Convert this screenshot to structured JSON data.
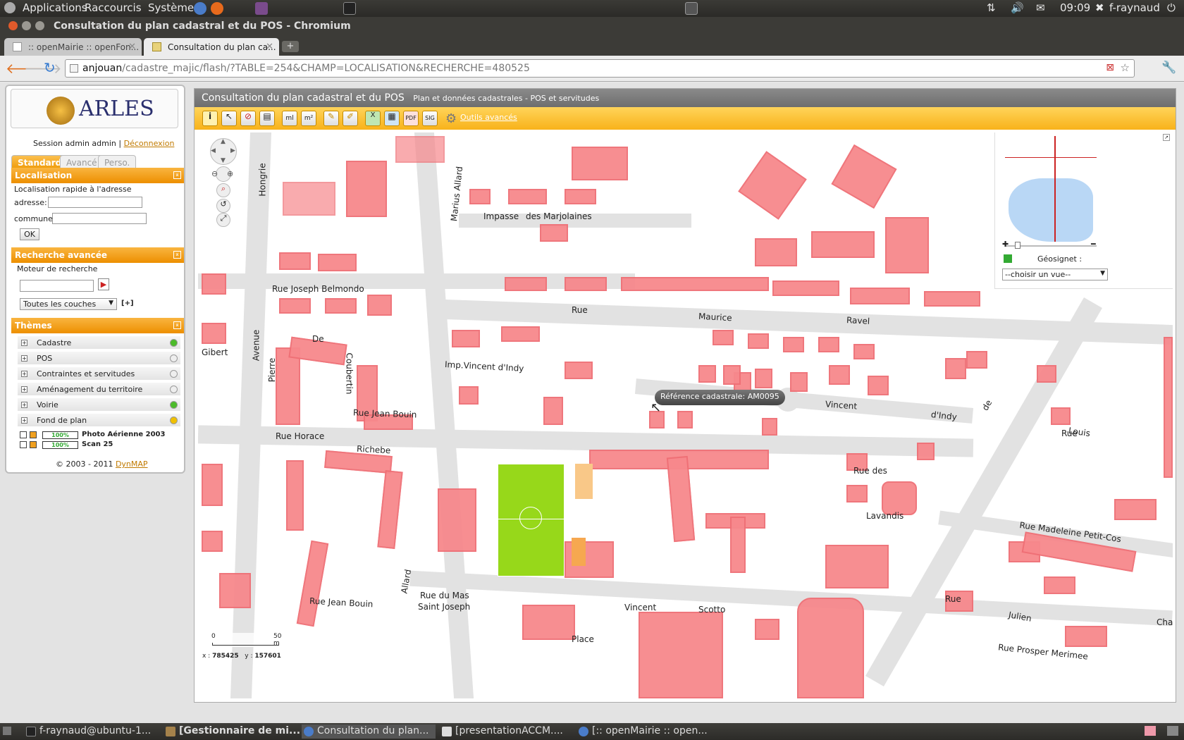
{
  "system_panel": {
    "menus": [
      "Applications",
      "Raccourcis",
      "Système"
    ],
    "clock": "09:09",
    "user": "f-raynaud"
  },
  "window": {
    "title": "Consultation du plan cadastral et du POS - Chromium"
  },
  "tabs": [
    {
      "label": ":: openMairie :: openFon...",
      "active": false
    },
    {
      "label": "Consultation du plan ca...",
      "active": true
    }
  ],
  "url": {
    "host": "anjouan",
    "path": "/cadastre_majic/flash/?TABLE=254&CHAMP=LOCALISATION&RECHERCHE=480525"
  },
  "left_panel": {
    "logo_text": "ARLES",
    "session_text": "Session admin admin |",
    "logout_link": "Déconnexion",
    "tabs": [
      "Standard",
      "Avancé",
      "Perso."
    ],
    "localisation": {
      "header": "Localisation",
      "quick_label": "Localisation rapide à l'adresse",
      "address_label": "adresse:",
      "commune_label": "commune",
      "ok_label": "OK"
    },
    "advanced": {
      "header": "Recherche avancée",
      "engine_label": "Moteur de recherche",
      "layers_select": "Toutes les couches",
      "expand": "[+]"
    },
    "themes": {
      "header": "Thèmes",
      "items": [
        {
          "label": "Cadastre",
          "status_color": "#4cbb2a"
        },
        {
          "label": "POS",
          "status_color": "#dddddd"
        },
        {
          "label": "Contraintes et servitudes",
          "status_color": "#dddddd"
        },
        {
          "label": "Aménagement du territoire",
          "status_color": "#dddddd"
        },
        {
          "label": "Voirie",
          "status_color": "#4cbb2a"
        },
        {
          "label": "Fond de plan",
          "status_color": "#f0c000"
        }
      ],
      "layers": [
        {
          "opacity": "100%",
          "label": "Photo Aérienne 2003"
        },
        {
          "opacity": "100%",
          "label": "Scan 25"
        }
      ]
    },
    "footer": {
      "copyright": "© 2003 - 2011",
      "brand": "DynMAP"
    }
  },
  "map_window": {
    "title": "Consultation du plan cadastral et du POS",
    "subtitle": "Plan et données cadastrales - POS et servitudes",
    "tools_link": "Outils avancés",
    "tooltip": "Référence cadastrale: AM0095",
    "scale": {
      "zero": "0",
      "max": "50 m"
    },
    "coords": {
      "x": "785425",
      "y": "157601"
    },
    "overview": {
      "geosignet_label": "Géosignet :",
      "view_select": "--choisir un vue--"
    }
  },
  "street_labels": [
    "Impasse",
    "des Marjolaines",
    "Rue Joseph Belmondo",
    "Rue",
    "Maurice",
    "Ravel",
    "Imp.Vincent d'Indy",
    "Vincent",
    "d'Indy",
    "Rue Jean Bouin",
    "Rue Horace",
    "Richebe",
    "Rue des",
    "Lavandis",
    "Rue Madeleine Petit-Cos",
    "Rue du Mas",
    "Saint Joseph",
    "Rue Jean Bouin",
    "Vincent",
    "Scotto",
    "Place",
    "Julien",
    "Rue Prosper Merimee",
    "Hongrie",
    "Marius Allard",
    "Avenue",
    "Pierre",
    "Coubertin",
    "Gibert",
    "De",
    "Allard",
    "Louis",
    "Rue",
    "Rue",
    "de",
    "Cha"
  ],
  "taskbar": [
    "f-raynaud@ubuntu-1...",
    "[Gestionnaire de mi...",
    "Consultation du plan...",
    "[presentationACCM....",
    "[:: openMairie :: open..."
  ]
}
